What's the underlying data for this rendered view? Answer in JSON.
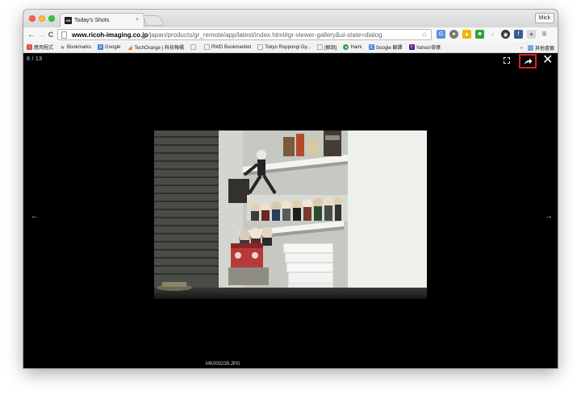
{
  "browser": {
    "tab_title": "Today's Shots",
    "tab_favicon": "GR",
    "tab_close": "×",
    "user": "Mick",
    "url_host": "www.ricoh-imaging.co.jp",
    "url_path": "/japan/products/gr_remote/app/latest/index.html#gr-viewer-gallery&ui-state=dialog",
    "nav": {
      "back_icon": "←",
      "forward_icon": "→",
      "reload_icon": "C",
      "menu_icon": "≡"
    }
  },
  "bookmarks": {
    "items": [
      {
        "label": "應用程式",
        "icon": "apps-icon",
        "color": "#e0524a"
      },
      {
        "label": "Bookmarks",
        "icon": "star-icon",
        "color": "#888888"
      },
      {
        "label": "Google",
        "icon": "google-icon",
        "color": "#4a7fe0"
      },
      {
        "label": "TechOrange | 科技報橘",
        "icon": "techorange-icon",
        "color": "#e67e22"
      },
      {
        "label": "",
        "icon": "page-icon",
        "color": "#aaaaaa"
      },
      {
        "label": "RWD Bookmarklet",
        "icon": "page-icon",
        "color": "#aaaaaa"
      },
      {
        "label": "Tokyo Roppongi Gy...",
        "icon": "page-icon",
        "color": "#aaaaaa"
      },
      {
        "label": "[解說]",
        "icon": "page-icon",
        "color": "#aaaaaa"
      },
      {
        "label": "Hami",
        "icon": "hami-icon",
        "color": "#2ea043"
      },
      {
        "label": "Google 翻譯",
        "icon": "translate-icon",
        "color": "#4a7fe0"
      },
      {
        "label": "Yahoo!奇摩",
        "icon": "yahoo-icon",
        "color": "#5a1f8c"
      }
    ],
    "overflow": "»",
    "other_label": "其他書籤"
  },
  "viewer": {
    "counter": "8 / 13",
    "filename": "MK000239.JPG",
    "prev_arrow": "←",
    "next_arrow": "→",
    "close": "✕",
    "highlight_color": "#e11f1f",
    "image_description": "shelves-with-figures-photo"
  }
}
